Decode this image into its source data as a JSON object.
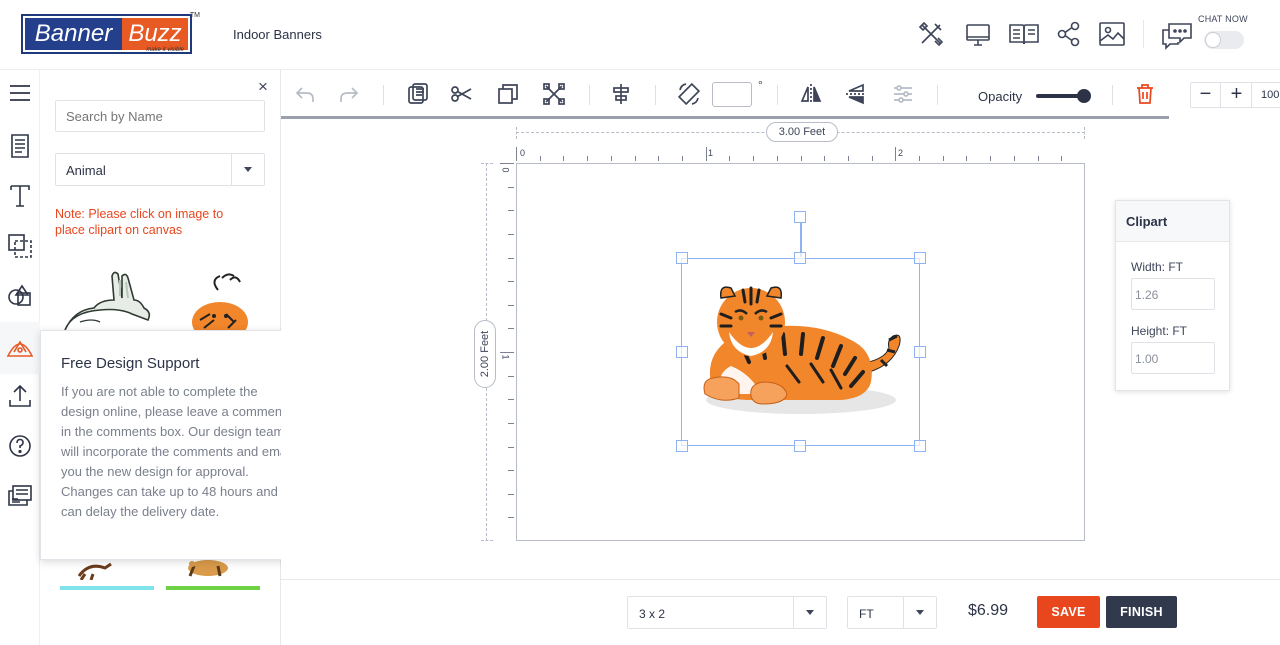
{
  "header": {
    "logo_banner": "Banner",
    "logo_buzz": "Buzz",
    "logo_tagline": "make it visible",
    "logo_tm": "TM",
    "product_title": "Indoor Banners",
    "chat_now": "CHAT NOW",
    "icons": [
      "tools-icon",
      "monitor-icon",
      "book-icon",
      "share-icon",
      "image-icon",
      "chat-icon"
    ]
  },
  "left_nav": {
    "items": [
      "menu-icon",
      "template-icon",
      "text-icon",
      "layers-icon",
      "shapes-icon",
      "clipart-icon",
      "upload-icon",
      "help-icon",
      "comments-icon"
    ],
    "active": "clipart-icon"
  },
  "clipart_panel": {
    "close": "×",
    "search_placeholder": "Search by Name",
    "category_selected": "Animal",
    "note": "Note: Please click on image to place clipart on canvas"
  },
  "support_popup": {
    "title": "Free Design Support",
    "close": "×",
    "body": "If you are not able to complete the design online, please leave a comments in the comments box. Our design team will incorporate the comments and email you the new design for approval. Changes can take up to 48 hours and can delay the delivery date."
  },
  "toolbar": {
    "angle_value": "",
    "degree_symbol": "°",
    "opacity_label": "Opacity",
    "opacity": 1.0,
    "zoom_minus": "−",
    "zoom_plus": "+",
    "zoom_value": "100"
  },
  "canvas": {
    "width_label": "3.00 Feet",
    "height_label": "2.00 Feet",
    "ruler_top": [
      "0",
      "1",
      "2"
    ],
    "ruler_left": [
      "0",
      "1"
    ]
  },
  "clipart_props": {
    "title": "Clipart",
    "width_label": "Width: FT",
    "width_value": "1.26",
    "height_label": "Height: FT",
    "height_value": "1.00"
  },
  "footer": {
    "size_selected": "3 x 2",
    "unit_selected": "FT",
    "price": "$6.99",
    "save": "SAVE",
    "finish": "FINISH"
  },
  "colors": {
    "brand_blue": "#243f8c",
    "brand_orange": "#e85a24",
    "note_red": "#e8471e",
    "finish_dark": "#313a4d",
    "selection_blue": "#8fb2f2"
  }
}
